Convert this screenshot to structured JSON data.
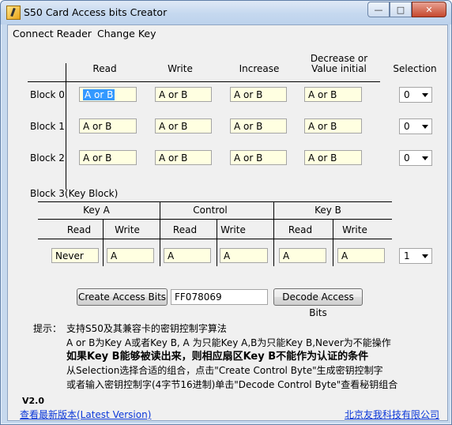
{
  "window": {
    "title": "S50 Card Access bits Creator"
  },
  "menu": [
    "Connect Reader",
    "Change Key"
  ],
  "blocks_table": {
    "headers": [
      "Read",
      "Write",
      "Increase",
      "Decrease or\nValue initial",
      "Selection"
    ],
    "rows": [
      {
        "label": "Block 0",
        "values": [
          "A or B",
          "A or B",
          "A or B",
          "A or B"
        ],
        "selection": "0"
      },
      {
        "label": "Block 1",
        "values": [
          "A or B",
          "A or B",
          "A or B",
          "A or B"
        ],
        "selection": "0"
      },
      {
        "label": "Block 2",
        "values": [
          "A or B",
          "A or B",
          "A or B",
          "A or B"
        ],
        "selection": "0"
      }
    ]
  },
  "key_block": {
    "title": "Block 3(Key Block)",
    "groups": [
      "Key A",
      "Control",
      "Key B"
    ],
    "subheaders": [
      "Read",
      "Write",
      "Read",
      "Write",
      "Read",
      "Write"
    ],
    "values": [
      "Never",
      "A",
      "A",
      "A",
      "A",
      "A"
    ],
    "selection": "1"
  },
  "actions": {
    "create_label": "Create Access Bits",
    "code_value": "FF078069",
    "decode_label": "Decode Access Bits"
  },
  "hint": {
    "label": "提示：",
    "lines": [
      "支持S50及其兼容卡的密钥控制字算法",
      "A or B为Key A或者Key B, A 为只能Key A,B为只能Key B,Never为不能操作",
      "如果Key B能够被读出来，则相应扇区Key B不能作为认证的条件",
      "从Selection选择合适的组合，点击\"Create Control Byte\"生成密钥控制字",
      "或者输入密钥控制字(4字节16进制)单击\"Decode Control Byte\"查看秘钥组合"
    ]
  },
  "footer": {
    "version": "V2.0",
    "latest_link": "查看最新版本(Latest Version)",
    "company_link": "北京友我科技有限公司"
  }
}
